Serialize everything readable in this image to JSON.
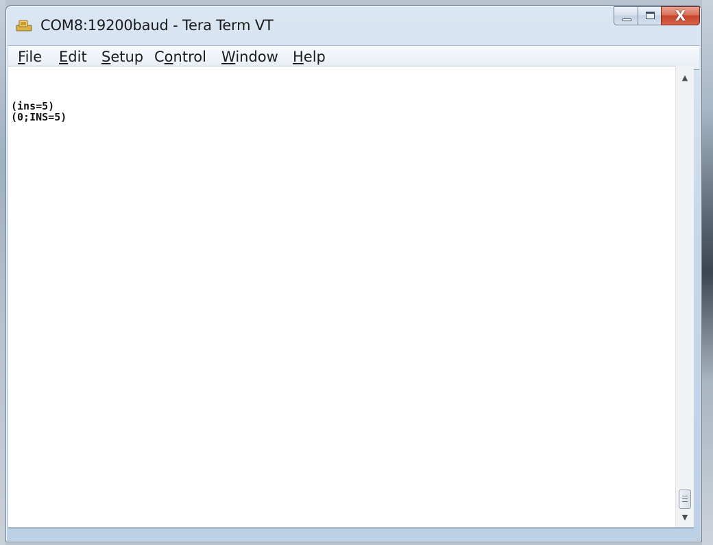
{
  "window": {
    "title": "COM8:19200baud - Tera Term VT",
    "icon": "tera-term-app-icon",
    "controls": {
      "minimize_icon": "minimize-icon",
      "maximize_icon": "maximize-icon",
      "close_label": "X"
    }
  },
  "menubar": {
    "items": [
      {
        "pre": "",
        "ul": "F",
        "post": "ile"
      },
      {
        "pre": "",
        "ul": "E",
        "post": "dit"
      },
      {
        "pre": "",
        "ul": "S",
        "post": "etup"
      },
      {
        "pre": "C",
        "ul": "o",
        "post": "ntrol"
      },
      {
        "pre": "",
        "ul": "W",
        "post": "indow"
      },
      {
        "pre": "",
        "ul": "H",
        "post": "elp"
      }
    ]
  },
  "terminal": {
    "lines": [
      "(ins=5)",
      "(0;INS=5)"
    ]
  },
  "scrollbar": {
    "up_arrow": "▲",
    "down_arrow": "▼"
  },
  "colors": {
    "title_gradient_top": "#dbe6f3",
    "close_button": "#c7452c",
    "terminal_bg": "#ffffff",
    "terminal_fg": "#111111"
  }
}
